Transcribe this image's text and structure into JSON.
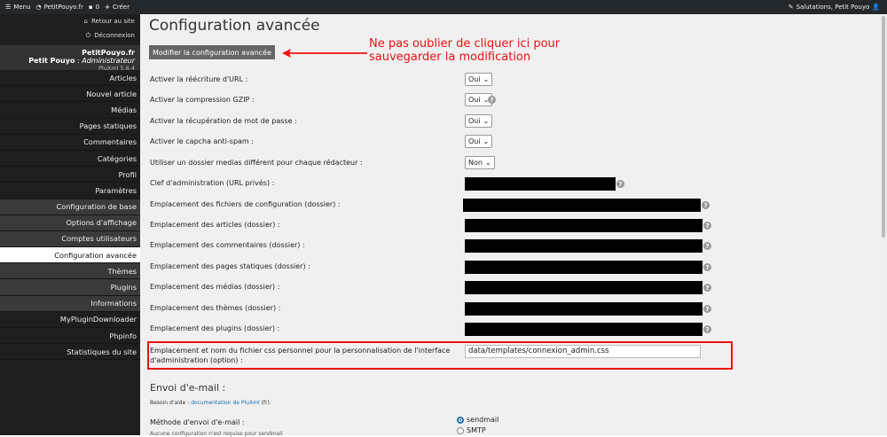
{
  "topbar": {
    "menu": "Menu",
    "site": "PetitPouyo.fr",
    "comments": "0",
    "create": "Créer",
    "greeting": "Salutations, Petit Pouyo"
  },
  "sidebar": {
    "back": "Retour au site",
    "logout": "Déconnexion",
    "site_name": "PetitPouyo.fr",
    "user_name": "Petit Pouyo",
    "user_role": "Administrateur",
    "version": "PluXml 5.8.4",
    "items": [
      {
        "label": "Articles",
        "type": "main"
      },
      {
        "label": "Nouvel article",
        "type": "main"
      },
      {
        "label": "Médias",
        "type": "main"
      },
      {
        "label": "Pages statiques",
        "type": "main"
      },
      {
        "label": "Commentaires",
        "type": "main"
      },
      {
        "label": "Catégories",
        "type": "main"
      },
      {
        "label": "Profil",
        "type": "main"
      },
      {
        "label": "Paramètres",
        "type": "main"
      },
      {
        "label": "Configuration de base",
        "type": "sub"
      },
      {
        "label": "Options d'affichage",
        "type": "sub"
      },
      {
        "label": "Comptes utilisateurs",
        "type": "sub"
      },
      {
        "label": "Configuration avancée",
        "type": "active"
      },
      {
        "label": "Thèmes",
        "type": "sub"
      },
      {
        "label": "Plugins",
        "type": "sub"
      },
      {
        "label": "Informations",
        "type": "sub"
      },
      {
        "label": "MyPluginDownloader",
        "type": "main"
      },
      {
        "label": "Phpinfo",
        "type": "main"
      },
      {
        "label": "Statistiques du site",
        "type": "main"
      }
    ]
  },
  "main": {
    "title": "Configuration avancée",
    "save_label": "Modifier la configuration avancée",
    "annotation_line1": "Ne pas oublier de cliquer ici pour",
    "annotation_line2": "sauvegarder la modification",
    "settings": [
      {
        "label": "Activer la réécriture d'URL :",
        "kind": "select",
        "value": "Oui",
        "help": false
      },
      {
        "label": "Activer la compression GZIP :",
        "kind": "select",
        "value": "Oui",
        "help": true
      },
      {
        "label": "Activer la récupération de mot de passe :",
        "kind": "select",
        "value": "Oui",
        "help": false
      },
      {
        "label": "Activer le capcha anti-spam :",
        "kind": "select",
        "value": "Oui",
        "help": false
      },
      {
        "label": "Utiliser un dossier medias différent pour chaque rédacteur :",
        "kind": "select",
        "value": "Non",
        "help": false
      },
      {
        "label": "Clef d'administration (URL privés) :",
        "kind": "redacted",
        "help": true
      },
      {
        "label": "Emplacement des fichiers de configuration (dossier) :",
        "kind": "redacted",
        "help": true
      },
      {
        "label": "Emplacement des articles (dossier) :",
        "kind": "redacted",
        "help": true
      },
      {
        "label": "Emplacement des commentaires (dossier) :",
        "kind": "redacted",
        "help": true
      },
      {
        "label": "Emplacement des pages statiques (dossier) :",
        "kind": "redacted",
        "help": true
      },
      {
        "label": "Emplacement des médias (dossier) :",
        "kind": "redacted",
        "help": true
      },
      {
        "label": "Emplacement des thèmes (dossier) :",
        "kind": "redacted",
        "help": true
      },
      {
        "label": "Emplacement des plugins (dossier) :",
        "kind": "redacted",
        "help": true
      }
    ],
    "css_label_line1": "Emplacement et nom du fichier css personnel pour la personnalisation de l'interface",
    "css_label_line2": "d'administration (option) :",
    "css_value": "data/templates/connexion_admin.css",
    "email_title": "Envoi d'e-mail :",
    "email_help_prefix": "Besoin d'aide :",
    "email_help_link": "documentation de PluXml",
    "email_help_suffix": "(fr).",
    "method_label": "Méthode d'envoi d'e-mail :",
    "method_options": [
      "sendmail",
      "SMTP"
    ],
    "no_config": "Aucune configuration n'est requise pour sendmail"
  },
  "colors": {
    "accent": "#e11111",
    "sidebar": "#1e1e1e",
    "topbar": "#23282d"
  }
}
